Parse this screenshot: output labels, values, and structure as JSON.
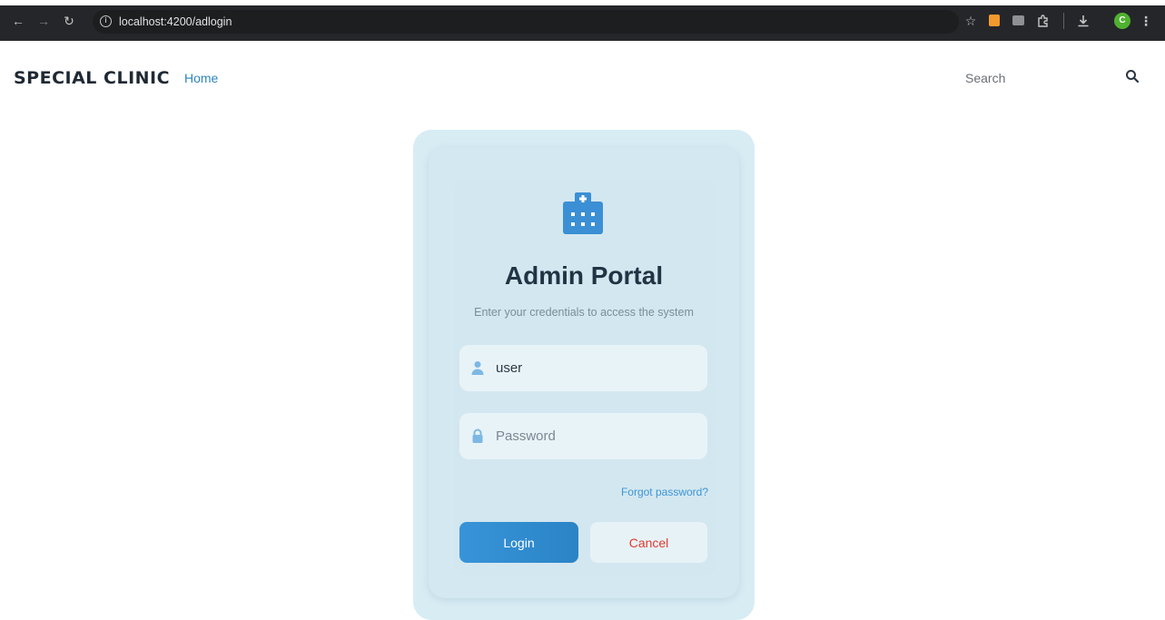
{
  "browser": {
    "url": "localhost:4200/adlogin",
    "avatar_letter": "C"
  },
  "navbar": {
    "brand": "SPECIAL CLINIC",
    "home_link": "Home",
    "search_placeholder": "Search"
  },
  "login": {
    "icon": "hospital-icon",
    "title": "Admin Portal",
    "subtitle": "Enter your credentials to access the system",
    "username_value": "user",
    "password_placeholder": "Password",
    "forgot_link": "Forgot password?",
    "login_label": "Login",
    "cancel_label": "Cancel"
  },
  "colors": {
    "accent": "#2e86c1",
    "card_bg": "#d4e8f1",
    "cancel_text": "#e03b2f",
    "title_text": "#223343"
  }
}
